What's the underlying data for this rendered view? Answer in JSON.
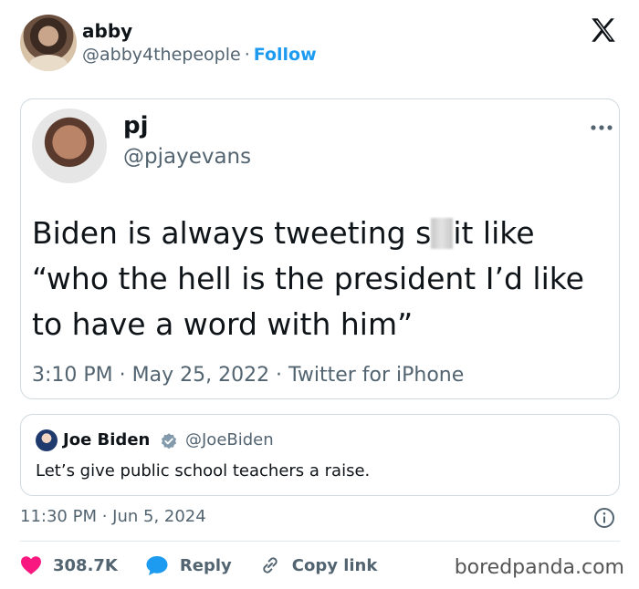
{
  "header": {
    "name": "abby",
    "handle": "@abby4thepeople",
    "separator": "·",
    "follow_label": "Follow"
  },
  "quoted_tweet": {
    "name": "pj",
    "handle": "@pjayevans",
    "text_before": "Biden is always tweeting s",
    "text_after": "it like “who the hell is the president I’d like to have a word with him”",
    "timestamp": "3:10 PM · May 25, 2022 · Twitter for iPhone"
  },
  "embedded_tweet": {
    "name": "Joe Biden",
    "handle": "@JoeBiden",
    "text": "Let’s give public school teachers a raise."
  },
  "meta": {
    "time": "11:30 PM · Jun 5, 2024"
  },
  "actions": {
    "likes": "308.7K",
    "reply_label": "Reply",
    "copy_label": "Copy link"
  },
  "watermark": "boredpanda.com",
  "colors": {
    "accent": "#1d9bf0",
    "like": "#f91880",
    "muted": "#536471"
  }
}
